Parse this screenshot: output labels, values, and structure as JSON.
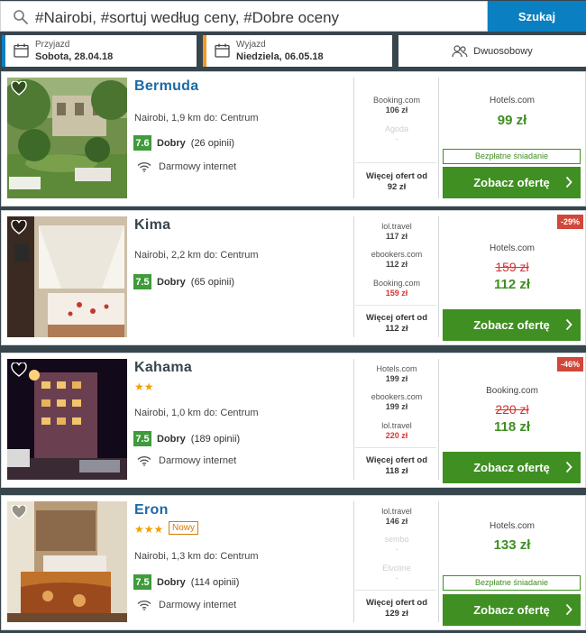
{
  "search": {
    "query": "#Nairobi, #sortuj według ceny, #Dobre oceny",
    "button": "Szukaj"
  },
  "dates": {
    "checkin_label": "Przyjazd",
    "checkin_value": "Sobota, 28.04.18",
    "checkout_label": "Wyjazd",
    "checkout_value": "Niedziela, 06.05.18"
  },
  "room": {
    "label": "Dwuosobowy"
  },
  "hotels": [
    {
      "name": "Bermuda",
      "location": "Nairobi, 1,9 km do: Centrum",
      "score": "7.6",
      "rating_word": "Dobry",
      "reviews": "(26 opinii)",
      "amenity": "Darmowy internet",
      "providers": [
        {
          "name": "Booking.com",
          "price": "106 zł"
        },
        {
          "name": "Agoda",
          "price": "-"
        }
      ],
      "more_label": "Więcej ofert od",
      "more_price": "92 zł",
      "deal_provider": "Hotels.com",
      "deal_price": "99 zł",
      "breakfast": "Bezpłatne śniadanie",
      "cta": "Zobacz ofertę"
    },
    {
      "name": "Kima",
      "location": "Nairobi, 2,2 km do: Centrum",
      "score": "7.5",
      "rating_word": "Dobry",
      "reviews": "(65 opinii)",
      "providers": [
        {
          "name": "lol.travel",
          "price": "117 zł"
        },
        {
          "name": "ebookers.com",
          "price": "112 zł"
        },
        {
          "name": "Booking.com",
          "price": "159 zł"
        }
      ],
      "more_label": "Więcej ofert od",
      "more_price": "112 zł",
      "discount": "-29%",
      "deal_provider": "Hotels.com",
      "old_price": "159 zł",
      "deal_price": "112 zł",
      "cta": "Zobacz ofertę"
    },
    {
      "name": "Kahama",
      "stars": "★★",
      "location": "Nairobi, 1,0 km do: Centrum",
      "score": "7.5",
      "rating_word": "Dobry",
      "reviews": "(189 opinii)",
      "amenity": "Darmowy internet",
      "providers": [
        {
          "name": "Hotels.com",
          "price": "199 zł"
        },
        {
          "name": "ebookers.com",
          "price": "199 zł"
        },
        {
          "name": "lol.travel",
          "price": "220 zł"
        }
      ],
      "more_label": "Więcej ofert od",
      "more_price": "118 zł",
      "discount": "-46%",
      "deal_provider": "Booking.com",
      "old_price": "220 zł",
      "deal_price": "118 zł",
      "cta": "Zobacz ofertę"
    },
    {
      "name": "Eron",
      "stars": "★★★",
      "badge": "Nowy",
      "location": "Nairobi, 1,3 km do: Centrum",
      "score": "7.5",
      "rating_word": "Dobry",
      "reviews": "(114 opinii)",
      "amenity": "Darmowy internet",
      "providers": [
        {
          "name": "lol.travel",
          "price": "146 zł"
        },
        {
          "name": "sembo",
          "price": "-"
        },
        {
          "name": "Elvoline",
          "price": "-"
        }
      ],
      "more_label": "Więcej ofert od",
      "more_price": "129 zł",
      "deal_provider": "Hotels.com",
      "deal_price": "133 zł",
      "breakfast": "Bezpłatne śniadanie",
      "cta": "Zobacz ofertę"
    }
  ],
  "colors": {
    "header_bg": "#37454d",
    "accent_blue": "#0a7fc1",
    "accent_orange": "#f19a28",
    "deal_green": "#3f8f22",
    "discount_red": "#d1473a"
  },
  "icons": [
    "search-icon",
    "calendar-icon",
    "users-icon",
    "heart-icon",
    "wifi-icon",
    "chevron-right-icon"
  ]
}
